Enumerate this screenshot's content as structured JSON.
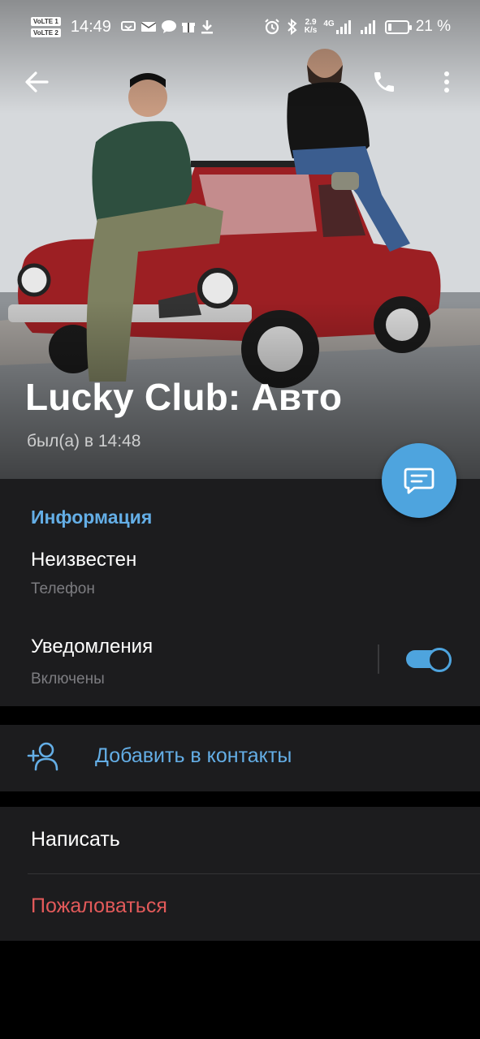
{
  "status_bar": {
    "sim1_label": "VoLTE 1",
    "sim2_label": "VoLTE 2",
    "time": "14:49",
    "net_speed_value": "2.9",
    "net_speed_unit": "K/s",
    "network_type": "4G",
    "battery_percent_text": "21 %",
    "battery_level": 0.21,
    "icons": [
      "volte-icon",
      "notification-icons",
      "alarm-icon",
      "bluetooth-icon",
      "signal-icon",
      "battery-icon"
    ]
  },
  "toolbar": {
    "back_icon": "arrow-left-icon",
    "call_icon": "phone-icon",
    "more_icon": "more-vertical-icon"
  },
  "profile": {
    "name": "Lucky Club: Авто",
    "last_seen": "был(а) в 14:48"
  },
  "fab": {
    "icon": "message-icon"
  },
  "info": {
    "title": "Информация",
    "phone_value": "Неизвестен",
    "phone_label": "Телефон",
    "notifications_label": "Уведомления",
    "notifications_state": "Включены",
    "notifications_enabled": true
  },
  "add_contact": {
    "icon": "add-user-icon",
    "label": "Добавить в контакты"
  },
  "actions": {
    "write_label": "Написать",
    "report_label": "Пожаловаться"
  },
  "colors": {
    "accent": "#4ea4de",
    "link_text": "#64aee6",
    "danger": "#e35a5a",
    "section_bg": "#1c1c1e",
    "page_bg": "#000000"
  }
}
